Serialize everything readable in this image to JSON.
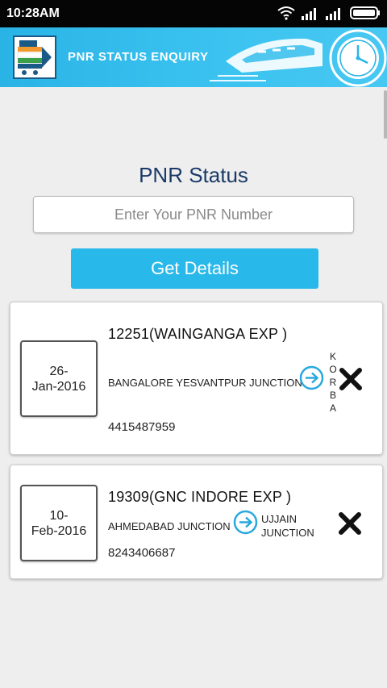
{
  "status_bar": {
    "time": "10:28AM"
  },
  "header": {
    "title": "PNR STATUS ENQUIRY"
  },
  "main": {
    "title": "PNR Status",
    "pnr_input": {
      "placeholder": "Enter Your PNR Number",
      "value": ""
    },
    "get_details_label": "Get Details"
  },
  "cards": [
    {
      "date_line1": "26-",
      "date_line2": "Jan-2016",
      "train": "12251(WAINGANGA EXP  )",
      "from": "BANGALORE YESVANTPUR JUNCTION",
      "to": "KORBA",
      "pnr": "4415487959"
    },
    {
      "date_line1": "10-",
      "date_line2": "Feb-2016",
      "train": "19309(GNC INDORE EXP )",
      "from": "AHMEDABAD JUNCTION",
      "to": "UJJAIN JUNCTION",
      "pnr": "8243406687"
    }
  ],
  "icons": {
    "wifi": "wifi-icon",
    "signal": "signal-icon",
    "battery": "battery-icon",
    "arrow": "arrow-right-circle-icon",
    "delete": "close-icon"
  },
  "colors": {
    "header": "#2ab4e6",
    "button": "#29b8ea",
    "title": "#1b3a67"
  }
}
